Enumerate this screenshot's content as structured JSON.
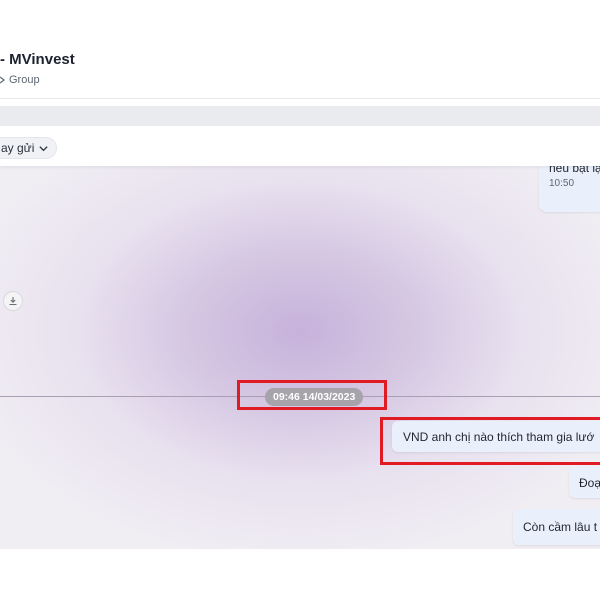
{
  "header": {
    "title": "- MVinvest",
    "subtitle": "Group"
  },
  "filter": {
    "label": "ay gửi"
  },
  "messages": {
    "top": {
      "text": "nếu bật lạ",
      "time": "10:50"
    },
    "date_separator": "09:46 14/03/2023",
    "vnd": "VND anh chị nào thích tham gia lướ",
    "doa": "Đoạ",
    "con": "Còn cầm lâu t"
  },
  "colors": {
    "highlight": "#e01b24",
    "bubble": "#eaf0fb",
    "date_pill": "#a6a3ab"
  }
}
